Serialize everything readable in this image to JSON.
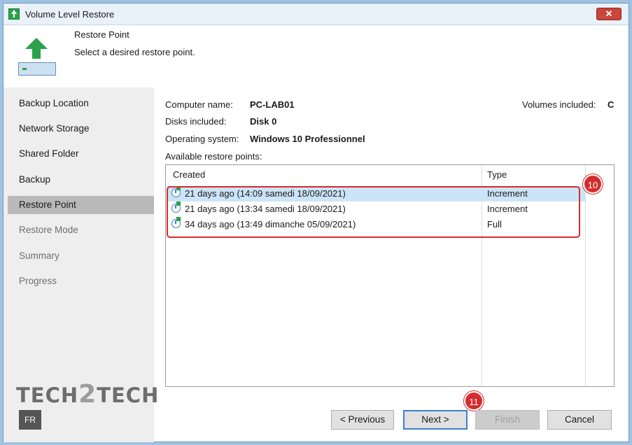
{
  "window": {
    "title": "Volume Level Restore",
    "close_label": "✕"
  },
  "header": {
    "title": "Restore Point",
    "subtitle": "Select a desired restore point."
  },
  "sidebar": {
    "items": [
      {
        "label": "Backup Location"
      },
      {
        "label": "Network Storage"
      },
      {
        "label": "Shared Folder"
      },
      {
        "label": "Backup"
      },
      {
        "label": "Restore Point"
      },
      {
        "label": "Restore Mode"
      },
      {
        "label": "Summary"
      },
      {
        "label": "Progress"
      }
    ],
    "active_item": "Restore Point"
  },
  "info": {
    "computer_name_label": "Computer name:",
    "computer_name_value": "PC-LAB01",
    "disks_label": "Disks included:",
    "disks_value": "Disk 0",
    "os_label": "Operating system:",
    "os_value": "Windows 10 Professionnel",
    "volumes_label": "Volumes included:",
    "volumes_value": "C",
    "available_label": "Available restore points:"
  },
  "table": {
    "columns": [
      "Created",
      "Type"
    ],
    "rows": [
      {
        "created": "21 days ago (14:09 samedi 18/09/2021)",
        "type": "Increment",
        "selected": true
      },
      {
        "created": "21 days ago (13:34 samedi 18/09/2021)",
        "type": "Increment",
        "selected": false
      },
      {
        "created": "34 days ago (13:49 dimanche 05/09/2021)",
        "type": "Full",
        "selected": false
      }
    ]
  },
  "annotations": {
    "badge_table": "10",
    "badge_next": "11"
  },
  "watermark": {
    "part1": "TECH",
    "part2": "2",
    "part3": "TECH"
  },
  "language_button": "FR",
  "buttons": {
    "previous": "< Previous",
    "next": "Next >",
    "finish": "Finish",
    "cancel": "Cancel"
  },
  "colors": {
    "accent_green": "#2ca24a",
    "highlight_red": "#d42c2c",
    "selection_blue": "#cce4f7"
  }
}
